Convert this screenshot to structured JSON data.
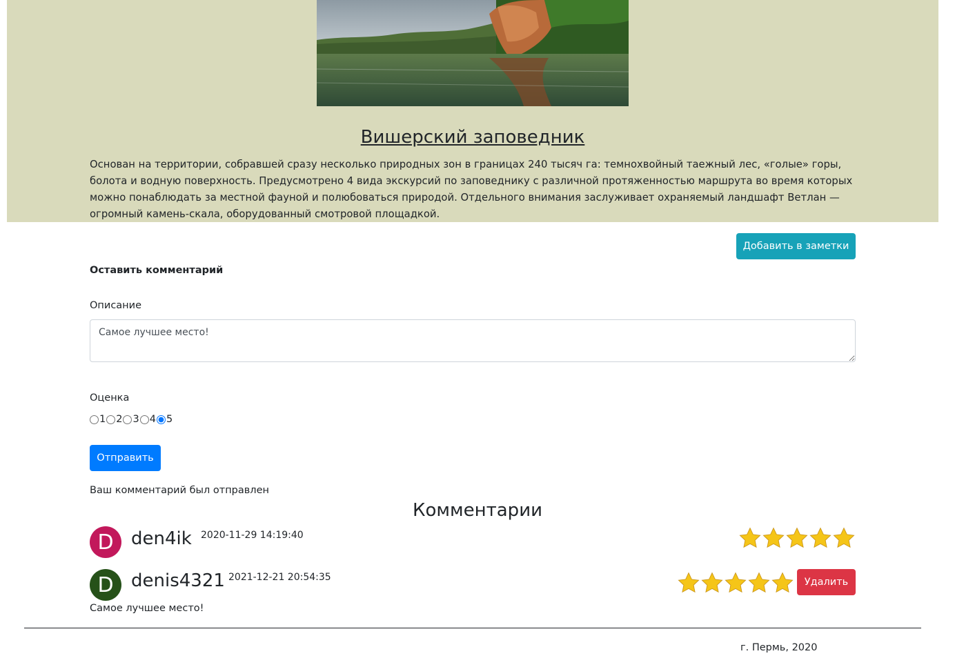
{
  "place": {
    "title": "Вишерский заповедник",
    "description": "Основан на территории, собравшей сразу несколько природных зон в границах 240 тысяч га: темнохвойный таежный лес, «голые» горы, болота и водную поверхность. Предусмотрено 4 вида экскурсий по заповеднику с различной протяженностью маршрута во время которых можно понаблюдать за местной фауной и полюбоваться природой. Отдельного внимания заслуживает охраняемый ландшафт Ветлан — огромный камень-скала, оборудованный смотровой площадкой.",
    "add_to_notes_label": "Добавить в заметки"
  },
  "comment_form": {
    "heading": "Оставить комментарий",
    "description_label": "Описание",
    "description_value": "Самое лучшее место!",
    "rating_label": "Оценка",
    "rating_options": [
      "1",
      "2",
      "3",
      "4",
      "5"
    ],
    "rating_selected": "5",
    "submit_label": "Отправить",
    "status_message": "Ваш комментарий был отправлен"
  },
  "comments_section": {
    "title": "Комментарии",
    "items": [
      {
        "avatar_letter": "D",
        "avatar_color": "#c2185b",
        "username": "den4ik",
        "date": "2020-11-29 14:19:40",
        "rating": 5,
        "text": ""
      },
      {
        "avatar_letter": "D",
        "avatar_color": "#265119",
        "username": "denis4321",
        "date": "2021-12-21 20:54:35",
        "rating": 5,
        "text": "Самое лучшее место!",
        "delete_label": "Удалить"
      }
    ]
  },
  "footer": {
    "text": "г. Пермь, 2020"
  },
  "colors": {
    "hero_background": "#d9dabb",
    "info_button": "#17a2b8",
    "primary_button": "#007bff",
    "danger_button": "#dc3545",
    "star": "#f5c518"
  }
}
